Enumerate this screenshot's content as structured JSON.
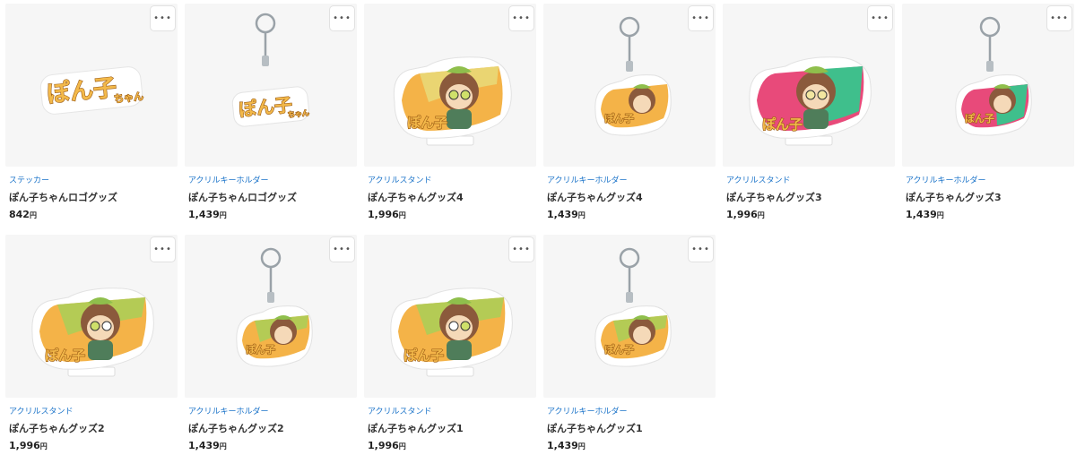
{
  "more_icon": "more-horizontal-icon",
  "products": [
    {
      "category": "ステッカー",
      "title": "ぽん子ちゃんロゴグッズ",
      "price": "842",
      "currency": "円",
      "kind": "sticker"
    },
    {
      "category": "アクリルキーホルダー",
      "title": "ぽん子ちゃんロゴグッズ",
      "price": "1,439",
      "currency": "円",
      "kind": "logo-keychain"
    },
    {
      "category": "アクリルスタンド",
      "title": "ぽん子ちゃんグッズ4",
      "price": "1,996",
      "currency": "円",
      "kind": "stand"
    },
    {
      "category": "アクリルキーホルダー",
      "title": "ぽん子ちゃんグッズ4",
      "price": "1,439",
      "currency": "円",
      "kind": "keychain"
    },
    {
      "category": "アクリルスタンド",
      "title": "ぽん子ちゃんグッズ3",
      "price": "1,996",
      "currency": "円",
      "kind": "stand-pink"
    },
    {
      "category": "アクリルキーホルダー",
      "title": "ぽん子ちゃんグッズ3",
      "price": "1,439",
      "currency": "円",
      "kind": "keychain-pink"
    },
    {
      "category": "アクリルスタンド",
      "title": "ぽん子ちゃんグッズ2",
      "price": "1,996",
      "currency": "円",
      "kind": "stand"
    },
    {
      "category": "アクリルキーホルダー",
      "title": "ぽん子ちゃんグッズ2",
      "price": "1,439",
      "currency": "円",
      "kind": "keychain"
    },
    {
      "category": "アクリルスタンド",
      "title": "ぽん子ちゃんグッズ1",
      "price": "1,996",
      "currency": "円",
      "kind": "stand"
    },
    {
      "category": "アクリルキーホルダー",
      "title": "ぽん子ちゃんグッズ1",
      "price": "1,439",
      "currency": "円",
      "kind": "keychain"
    }
  ],
  "logo_text": "ぽん子ちゃん"
}
